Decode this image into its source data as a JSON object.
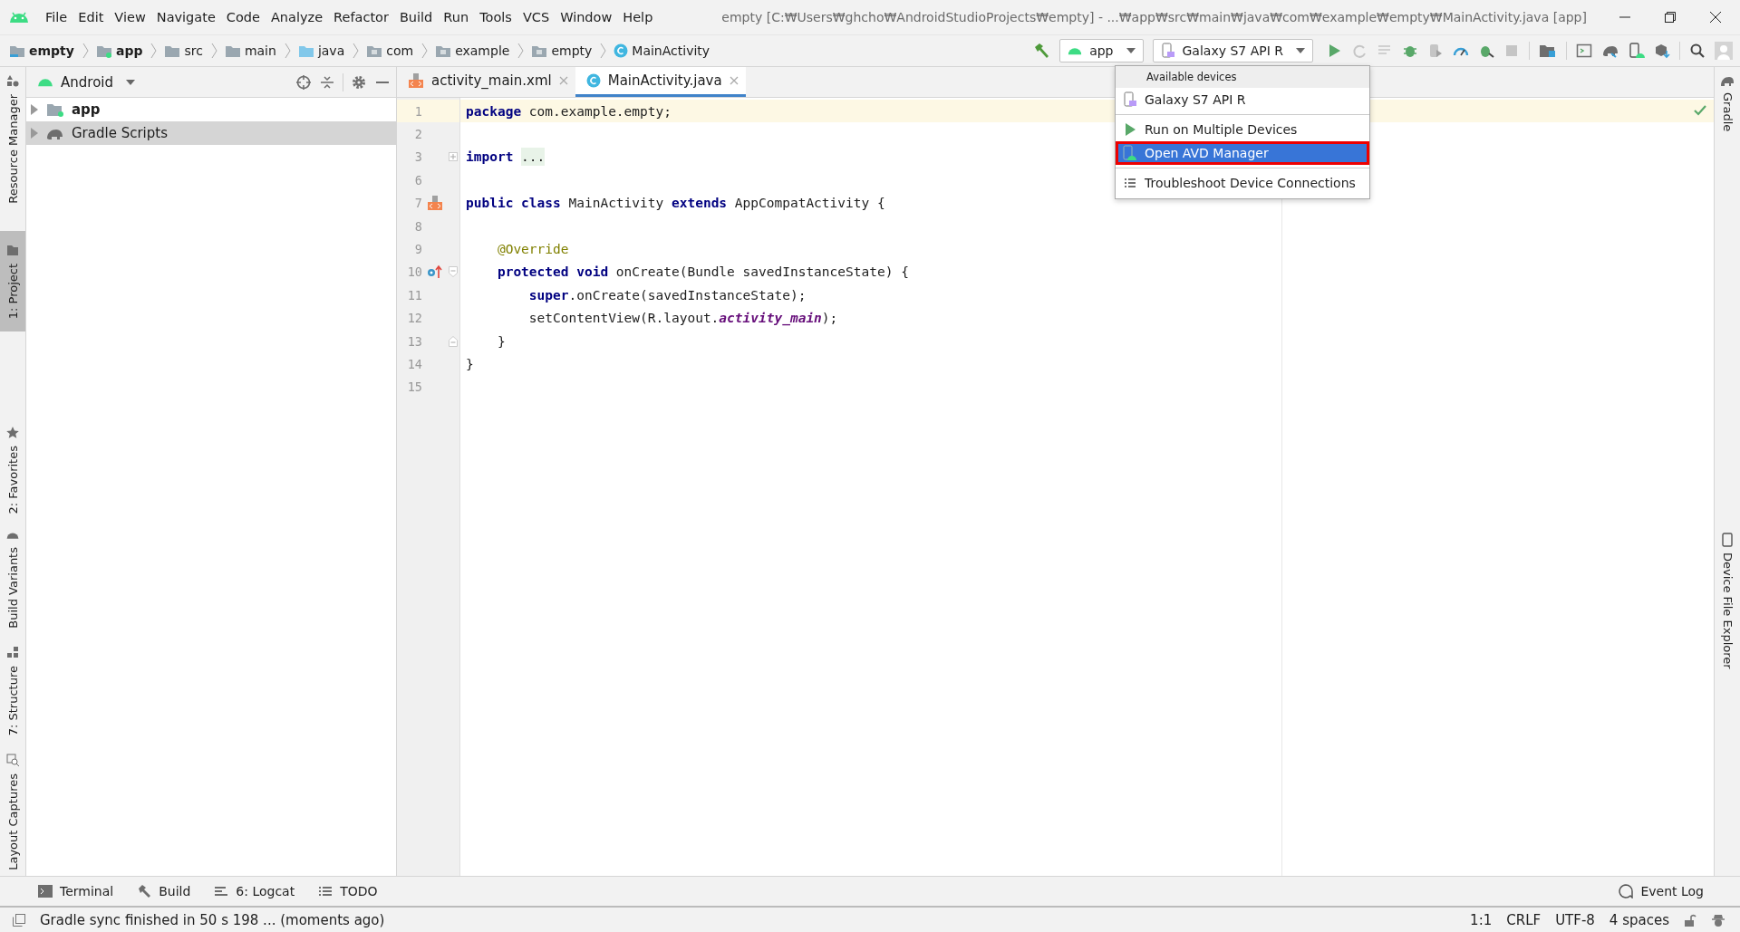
{
  "menu": [
    "File",
    "Edit",
    "View",
    "Navigate",
    "Code",
    "Analyze",
    "Refactor",
    "Build",
    "Run",
    "Tools",
    "VCS",
    "Window",
    "Help"
  ],
  "window": {
    "title": "empty [C:₩Users₩ghcho₩AndroidStudioProjects₩empty] - ...₩app₩src₩main₩java₩com₩example₩empty₩MainActivity.java [app]"
  },
  "breadcrumbs": [
    {
      "label": "empty",
      "kind": "module"
    },
    {
      "label": "app",
      "kind": "app"
    },
    {
      "label": "src",
      "kind": "folder"
    },
    {
      "label": "main",
      "kind": "folder"
    },
    {
      "label": "java",
      "kind": "source"
    },
    {
      "label": "com",
      "kind": "package"
    },
    {
      "label": "example",
      "kind": "package"
    },
    {
      "label": "empty",
      "kind": "package"
    },
    {
      "label": "MainActivity",
      "kind": "class"
    }
  ],
  "toolbar": {
    "run_config": "app",
    "device": "Galaxy S7 API R"
  },
  "device_menu": {
    "header": "Available devices",
    "items": [
      {
        "label": "Galaxy S7 API R",
        "kind": "device",
        "separator_before": false,
        "selected": false
      },
      {
        "label": "Run on Multiple Devices",
        "kind": "run",
        "separator_before": true,
        "selected": false
      },
      {
        "label": "Open AVD Manager",
        "kind": "avd",
        "separator_before": false,
        "selected": true
      },
      {
        "label": "Troubleshoot Device Connections",
        "kind": "list",
        "separator_before": true,
        "selected": false
      }
    ]
  },
  "left_strip": [
    {
      "label": "Resource Manager",
      "kind": "resources",
      "selected": false
    },
    {
      "label": "1: Project",
      "kind": "project",
      "selected": true
    },
    {
      "label": "2: Favorites",
      "kind": "favorites",
      "selected": false
    },
    {
      "label": "Build Variants",
      "kind": "variants",
      "selected": false
    },
    {
      "label": "7: Structure",
      "kind": "structure",
      "selected": false
    },
    {
      "label": "Layout Captures",
      "kind": "captures",
      "selected": false
    }
  ],
  "right_strip": [
    {
      "label": "Gradle",
      "kind": "gradle"
    },
    {
      "label": "Device File Explorer",
      "kind": "device"
    }
  ],
  "project": {
    "view": "Android",
    "items": [
      {
        "label": "app",
        "kind": "app",
        "expanded": false,
        "selected": false
      },
      {
        "label": "Gradle Scripts",
        "kind": "gradle",
        "expanded": false,
        "selected": true
      }
    ]
  },
  "tabs": [
    {
      "label": "activity_main.xml",
      "kind": "xml",
      "selected": false
    },
    {
      "label": "MainActivity.java",
      "kind": "class",
      "selected": true
    }
  ],
  "code": [
    {
      "number": "1",
      "current": true,
      "tokens": [
        {
          "kind": "keyword",
          "text": "package"
        },
        {
          "kind": "plain",
          "text": " com.example.empty;"
        }
      ]
    },
    {
      "number": "2",
      "current": false
    },
    {
      "number": "3",
      "current": false,
      "fold": {
        "kind": "collapsed"
      },
      "tokens": [
        {
          "kind": "keyword",
          "text": "import"
        },
        {
          "kind": "folded",
          "text": "..."
        }
      ]
    },
    {
      "number": "6",
      "current": false
    },
    {
      "number": "7",
      "current": false,
      "marker": {
        "kind": "layout"
      },
      "tokens": [
        {
          "kind": "keyword",
          "text": "public class"
        },
        {
          "kind": "plain",
          "text": " MainActivity "
        },
        {
          "kind": "keyword",
          "text": "extends"
        },
        {
          "kind": "plain",
          "text": " AppCompatActivity {"
        }
      ]
    },
    {
      "number": "8",
      "current": false
    },
    {
      "number": "9",
      "current": false,
      "tokens": [
        {
          "kind": "annotation",
          "text": "    @Override"
        }
      ]
    },
    {
      "number": "10",
      "current": false,
      "marker": {
        "kind": "override"
      },
      "fold": {
        "kind": "start"
      },
      "tokens": [
        {
          "kind": "keyword",
          "text": "    protected void"
        },
        {
          "kind": "plain",
          "text": " onCreate(Bundle savedInstanceState) {"
        }
      ]
    },
    {
      "number": "11",
      "current": false,
      "tokens": [
        {
          "kind": "keyword",
          "text": "        super"
        },
        {
          "kind": "plain",
          "text": ".onCreate(savedInstanceState);"
        }
      ]
    },
    {
      "number": "12",
      "current": false,
      "tokens": [
        {
          "kind": "plain",
          "text": "        setContentView(R.layout."
        },
        {
          "kind": "field",
          "text": "activity_main"
        },
        {
          "kind": "plain",
          "text": ");"
        }
      ]
    },
    {
      "number": "13",
      "current": false,
      "fold": {
        "kind": "end"
      },
      "tokens": [
        {
          "kind": "plain",
          "text": "    }"
        }
      ]
    },
    {
      "number": "14",
      "current": false,
      "tokens": [
        {
          "kind": "plain",
          "text": "}"
        }
      ]
    },
    {
      "number": "15",
      "current": false
    }
  ],
  "bottom_tools": [
    {
      "label": "Terminal",
      "kind": "terminal"
    },
    {
      "label": "Build",
      "kind": "build"
    },
    {
      "label": "6: Logcat",
      "kind": "logcat"
    },
    {
      "label": "TODO",
      "kind": "todo"
    }
  ],
  "event_log": "Event Log",
  "status_bar": {
    "message": "Gradle sync finished in 50 s 198 ... (moments ago)",
    "items": [
      "1:1",
      "CRLF",
      "UTF-8",
      "4 spaces"
    ]
  }
}
